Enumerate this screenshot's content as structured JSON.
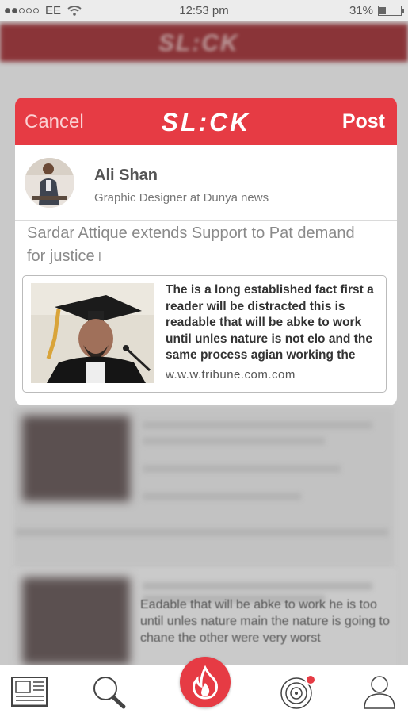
{
  "status_bar": {
    "carrier": "EE",
    "time": "12:53 pm",
    "battery": "31%"
  },
  "background": {
    "logo": "SL:CK",
    "snippet": "Eadable that will be abke to  work he is  too until unles nature main the nature is going  to chane the other were very worst"
  },
  "modal": {
    "cancel_label": "Cancel",
    "logo": "SL:CK",
    "post_label": "Post",
    "user": {
      "name": "Ali Shan",
      "title": "Graphic Designer at Dunya news"
    },
    "post_text": "Sardar Attique extends Support to Pat demand for justice",
    "cursor": "I",
    "link_preview": {
      "description": "The is a long established fact first a reader will be distracted this  is readable that will be abke to  work until unles nature is not elo and the same process agian working the",
      "url": "w.w.w.tribune.com.com"
    }
  },
  "bottom_nav": {
    "items": [
      "news-icon",
      "search-icon",
      "trending-icon",
      "radar-icon",
      "profile-icon"
    ]
  },
  "colors": {
    "accent": "#e63b44",
    "header_text": "#ffffff"
  }
}
